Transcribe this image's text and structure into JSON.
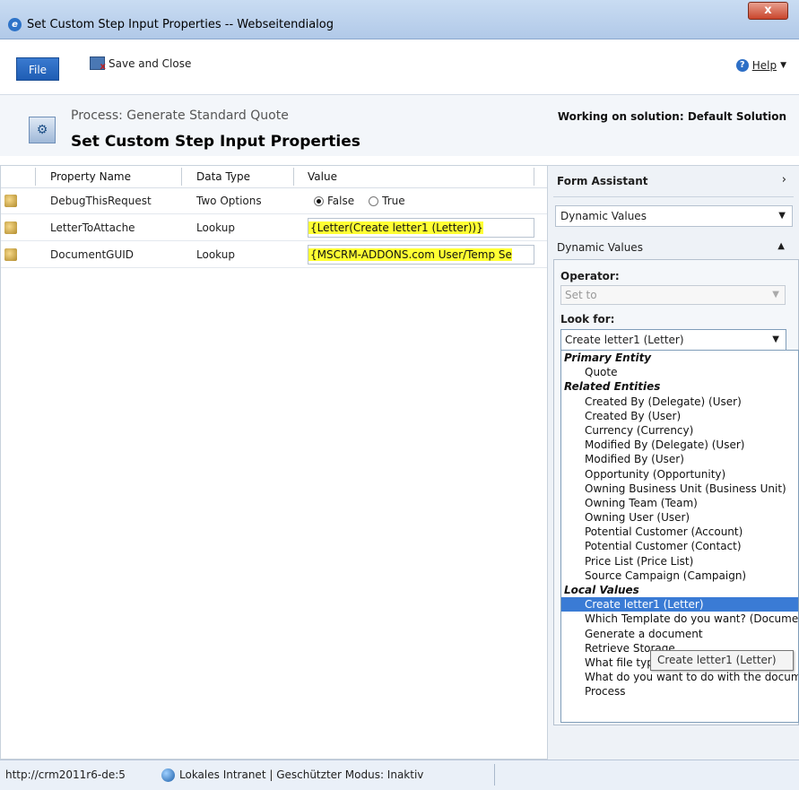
{
  "window": {
    "title": "Set Custom Step Input Properties -- Webseitendialog",
    "close_label": "x"
  },
  "ribbon": {
    "file_label": "File",
    "save_close_label": "Save and Close",
    "help_label": "Help"
  },
  "header": {
    "process_label": "Process: Generate Standard Quote",
    "page_title": "Set Custom Step Input Properties",
    "solution_label": "Working on solution: Default Solution"
  },
  "table": {
    "columns": [
      "Property Name",
      "Data Type",
      "Value"
    ],
    "rows": [
      {
        "name": "DebugThisRequest",
        "type": "Two Options",
        "options": [
          "False",
          "True"
        ],
        "selected": "False"
      },
      {
        "name": "LetterToAttache",
        "type": "Lookup",
        "value": "{Letter(Create letter1 (Letter))}"
      },
      {
        "name": "DocumentGUID",
        "type": "Lookup",
        "value": "{MSCRM-ADDONS.com User/Temp Se"
      }
    ]
  },
  "form_assistant": {
    "title": "Form Assistant",
    "select_value": "Dynamic Values",
    "section_title": "Dynamic Values",
    "operator_label": "Operator:",
    "operator_value": "Set to",
    "look_for_label": "Look for:",
    "look_for_value": "Create letter1 (Letter)",
    "list": [
      {
        "text": "Primary Entity",
        "group": true
      },
      {
        "text": "Quote"
      },
      {
        "text": "Related Entities",
        "group": true
      },
      {
        "text": "Created By (Delegate) (User)"
      },
      {
        "text": "Created By (User)"
      },
      {
        "text": "Currency (Currency)"
      },
      {
        "text": "Modified By (Delegate) (User)"
      },
      {
        "text": "Modified By (User)"
      },
      {
        "text": "Opportunity (Opportunity)"
      },
      {
        "text": "Owning Business Unit (Business Unit)"
      },
      {
        "text": "Owning Team (Team)"
      },
      {
        "text": "Owning User (User)"
      },
      {
        "text": "Potential Customer (Account)"
      },
      {
        "text": "Potential Customer (Contact)"
      },
      {
        "text": "Price List (Price List)"
      },
      {
        "text": "Source Campaign (Campaign)"
      },
      {
        "text": "Local Values",
        "group": true
      },
      {
        "text": "Create letter1 (Letter)",
        "selected": true
      },
      {
        "text": "Which Template do you want? (Document Template)"
      },
      {
        "text": "Generate a document"
      },
      {
        "text": "Retrieve Storage"
      },
      {
        "text": "What file type do you want?"
      },
      {
        "text": "What do you want to do with the document?"
      },
      {
        "text": "Process"
      }
    ],
    "tooltip": "Create letter1 (Letter)"
  },
  "statusbar": {
    "url": "http://crm2011r6-de:5",
    "zone": "Lokales Intranet | Geschützter Modus: Inaktiv"
  }
}
